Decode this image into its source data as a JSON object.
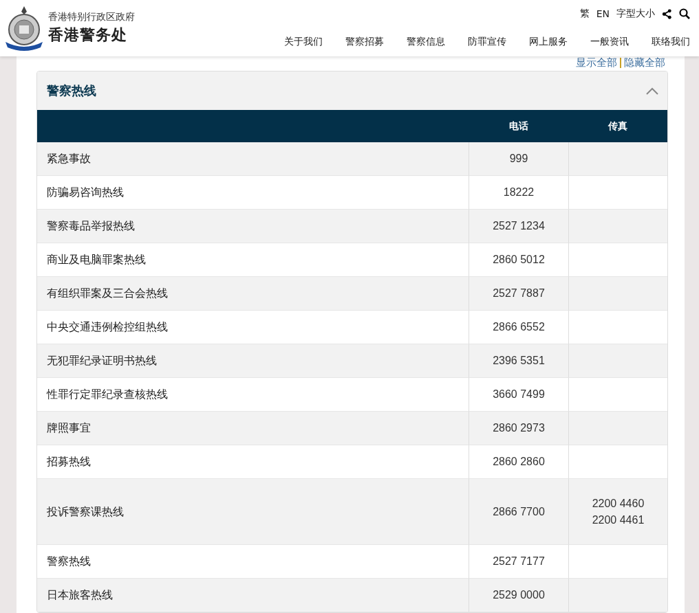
{
  "header": {
    "subtitle": "香港特别行政区政府",
    "title": "香港警务处",
    "utility": [
      {
        "kind": "text",
        "label": "繁"
      },
      {
        "kind": "text",
        "label": "EN"
      },
      {
        "kind": "text",
        "label": "字型大小"
      },
      {
        "kind": "share"
      },
      {
        "kind": "search"
      }
    ],
    "nav": [
      "关于我们",
      "警察招募",
      "警察信息",
      "防罪宣传",
      "网上服务",
      "一般资讯",
      "联络我们"
    ]
  },
  "toggle_links": [
    "显示全部",
    "隐藏全部"
  ],
  "section": {
    "title": "警察热线",
    "expanded": true,
    "table": {
      "columns": [
        "电话",
        "传真"
      ],
      "rows": [
        {
          "name": "紧急事故",
          "phone": [
            "999"
          ],
          "fax": []
        },
        {
          "name": "防骗易咨询热线",
          "phone": [
            "18222"
          ],
          "fax": []
        },
        {
          "name": "警察毒品举报热线",
          "phone": [
            "2527 1234"
          ],
          "fax": []
        },
        {
          "name": "商业及电脑罪案热线",
          "phone": [
            "2860 5012"
          ],
          "fax": []
        },
        {
          "name": "有组织罪案及三合会热线",
          "phone": [
            "2527 7887"
          ],
          "fax": []
        },
        {
          "name": "中央交通违例检控组热线",
          "phone": [
            "2866 6552"
          ],
          "fax": []
        },
        {
          "name": "无犯罪纪录证明书热线",
          "phone": [
            "2396 5351"
          ],
          "fax": []
        },
        {
          "name": "性罪行定罪纪录查核热线",
          "phone": [
            "3660 7499"
          ],
          "fax": []
        },
        {
          "name": "牌照事宜",
          "phone": [
            "2860 2973"
          ],
          "fax": []
        },
        {
          "name": "招募热线",
          "phone": [
            "2860 2860"
          ],
          "fax": []
        },
        {
          "name": "投诉警察课热线",
          "phone": [
            "2866 7700"
          ],
          "fax": [
            "2200 4460",
            "2200 4461"
          ]
        },
        {
          "name": "警察热线",
          "phone": [
            "2527 7177"
          ],
          "fax": []
        },
        {
          "name": "日本旅客热线",
          "phone": [
            "2529 0000"
          ],
          "fax": []
        }
      ]
    }
  }
}
